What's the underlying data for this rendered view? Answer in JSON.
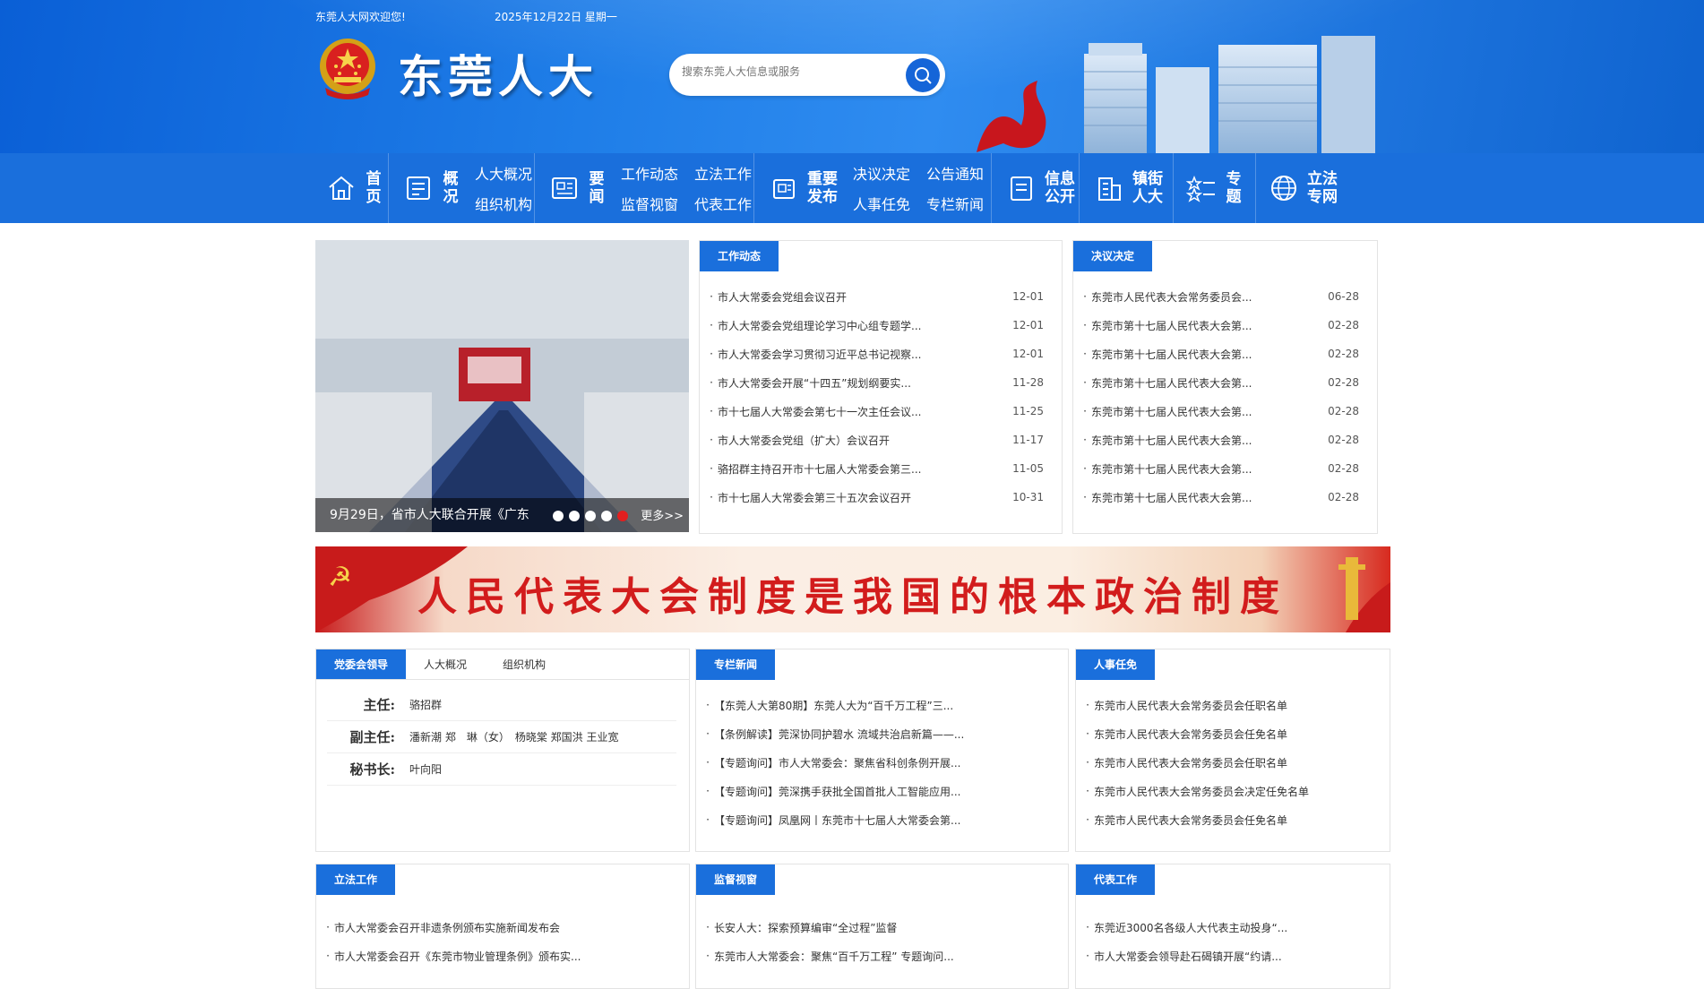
{
  "header": {
    "welcome": "东莞人大网欢迎您!",
    "date": "2025年12月22日 星期一",
    "logo_text": "东莞人大",
    "search_placeholder": "搜索东莞人大信息或服务"
  },
  "nav": [
    {
      "label": "首页",
      "icon": "home-icon",
      "subs": []
    },
    {
      "label": "概况",
      "icon": "overview-icon",
      "subs": [
        "人大概况",
        "组织机构"
      ]
    },
    {
      "label": "要闻",
      "icon": "news-icon",
      "subs": [
        "工作动态",
        "立法工作",
        "监督视窗",
        "代表工作"
      ]
    },
    {
      "label": "重要发布",
      "icon": "publish-icon",
      "subs": [
        "决议决定",
        "公告通知",
        "人事任免",
        "专栏新闻"
      ]
    },
    {
      "label": "信息公开",
      "icon": "document-icon",
      "subs": []
    },
    {
      "label": "镇街人大",
      "icon": "building-icon",
      "subs": []
    },
    {
      "label": "专题",
      "icon": "topics-icon",
      "subs": []
    },
    {
      "label": "立法专网",
      "icon": "globe-icon",
      "subs": []
    }
  ],
  "slider": {
    "caption": "9月29日，省市人大联合开展《广东",
    "more": "更多>>",
    "dot_count": 5,
    "active_dot": 5
  },
  "work_news": {
    "tab": "工作动态",
    "items": [
      {
        "title": "市人大常委会党组会议召开",
        "date": "12-01"
      },
      {
        "title": "市人大常委会党组理论学习中心组专题学...",
        "date": "12-01"
      },
      {
        "title": "市人大常委会学习贯彻习近平总书记视察...",
        "date": "12-01"
      },
      {
        "title": "市人大常委会开展“十四五”规划纲要实...",
        "date": "11-28"
      },
      {
        "title": "市十七届人大常委会第七十一次主任会议...",
        "date": "11-25"
      },
      {
        "title": "市人大常委会党组（扩大）会议召开",
        "date": "11-17"
      },
      {
        "title": "骆招群主持召开市十七届人大常委会第三...",
        "date": "11-05"
      },
      {
        "title": "市十七届人大常委会第三十五次会议召开",
        "date": "10-31"
      }
    ]
  },
  "resolutions": {
    "tab": "决议决定",
    "items": [
      {
        "title": "东莞市人民代表大会常务委员会...",
        "date": "06-28"
      },
      {
        "title": "东莞市第十七届人民代表大会第...",
        "date": "02-28"
      },
      {
        "title": "东莞市第十七届人民代表大会第...",
        "date": "02-28"
      },
      {
        "title": "东莞市第十七届人民代表大会第...",
        "date": "02-28"
      },
      {
        "title": "东莞市第十七届人民代表大会第...",
        "date": "02-28"
      },
      {
        "title": "东莞市第十七届人民代表大会第...",
        "date": "02-28"
      },
      {
        "title": "东莞市第十七届人民代表大会第...",
        "date": "02-28"
      },
      {
        "title": "东莞市第十七届人民代表大会第...",
        "date": "02-28"
      }
    ]
  },
  "banner": {
    "text": "人民代表大会制度是我国的根本政治制度"
  },
  "leaders": {
    "tabs": [
      "党委会领导",
      "人大概况",
      "组织机构"
    ],
    "rows": [
      {
        "role": "主任:",
        "names": "骆招群"
      },
      {
        "role": "副主任:",
        "names": "潘新潮 郑　琳（女）　杨晓棠 郑国洪 王业宽"
      },
      {
        "role": "秘书长:",
        "names": "叶向阳"
      }
    ]
  },
  "special_news": {
    "tab": "专栏新闻",
    "items": [
      "【东莞人大第80期】东莞人大为“百千万工程”三...",
      "【条例解读】莞深协同护碧水 流域共治启新篇——...",
      "【专题询问】市人大常委会：聚焦省科创条例开展...",
      "【专题询问】莞深携手获批全国首批人工智能应用...",
      "【专题询问】凤凰网丨东莞市十七届人大常委会第..."
    ]
  },
  "personnel": {
    "tab": "人事任免",
    "items": [
      "东莞市人民代表大会常务委员会任职名单",
      "东莞市人民代表大会常务委员会任免名单",
      "东莞市人民代表大会常务委员会任职名单",
      "东莞市人民代表大会常务委员会决定任免名单",
      "东莞市人民代表大会常务委员会任免名单"
    ]
  },
  "legislation": {
    "tab": "立法工作",
    "items": [
      "市人大常委会召开非遗条例颁布实施新闻发布会",
      "市人大常委会召开《东莞市物业管理条例》颁布实..."
    ]
  },
  "supervision": {
    "tab": "监督视窗",
    "items": [
      "长安人大：探索预算编审“全过程”监督",
      "东莞市人大常委会：聚焦“百千万工程” 专题询问..."
    ]
  },
  "deputies": {
    "tab": "代表工作",
    "items": [
      "东莞近3000名各级人大代表主动投身“...",
      "市人大常委会领导赴石碣镇开展“约请..."
    ]
  },
  "colors": {
    "primary": "#1a6fdc",
    "banner_red": "#d21c1c"
  }
}
